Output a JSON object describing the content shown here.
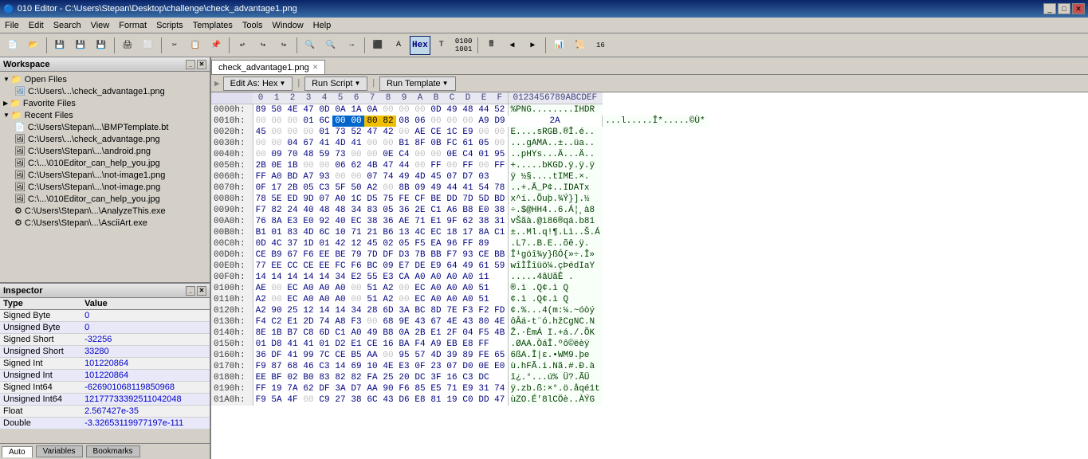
{
  "titlebar": {
    "title": "010 Editor - C:\\Users\\Stepan\\Desktop\\challenge\\check_advantage1.png"
  },
  "menubar": {
    "items": [
      "File",
      "Edit",
      "Search",
      "View",
      "Format",
      "Scripts",
      "Templates",
      "Tools",
      "Window",
      "Help"
    ]
  },
  "workspace": {
    "label": "Workspace",
    "open_files": {
      "label": "Open Files",
      "items": [
        "C:\\Users\\...\\check_advantage1.png"
      ]
    },
    "favorite_files": {
      "label": "Favorite Files"
    },
    "recent_files": {
      "label": "Recent Files",
      "items": [
        "C:\\Users\\Stepan\\...\\BMPTemplate.bt",
        "C:\\Users\\...\\check_advantage.png",
        "C:\\Users\\Stepan\\...\\android.png",
        "C:\\...\\010Editor_can_help_you.jpg",
        "C:\\Users\\Stepan\\...\\not-image1.png",
        "C:\\Users\\Stepan\\...\\not-image.png",
        "C:\\...\\010Editor_can_help_you.jpg",
        "C:\\Users\\Stepan\\...\\AnalyzeThis.exe",
        "C:\\Users\\Stepan\\...\\AsciiArt.exe"
      ]
    }
  },
  "inspector": {
    "label": "Inspector",
    "columns": [
      "Type",
      "Value"
    ],
    "rows": [
      {
        "type": "Signed Byte",
        "value": "0"
      },
      {
        "type": "Unsigned Byte",
        "value": "0"
      },
      {
        "type": "Signed Short",
        "value": "-32256"
      },
      {
        "type": "Unsigned Short",
        "value": "33280"
      },
      {
        "type": "Signed Int",
        "value": "101220864"
      },
      {
        "type": "Unsigned Int",
        "value": "101220864"
      },
      {
        "type": "Signed Int64",
        "value": "-626901068119850968"
      },
      {
        "type": "Unsigned Int64",
        "value": "12177733392511042048"
      },
      {
        "type": "Float",
        "value": "2.567427e-35"
      },
      {
        "type": "Double",
        "value": "-3.32653119977197e-111"
      }
    ],
    "tabs": [
      "Auto",
      "Variables",
      "Bookmarks"
    ]
  },
  "hex_editor": {
    "file_tab": "check_advantage1.png",
    "action_buttons": [
      "Edit As: Hex",
      "Run Script",
      "Run Template"
    ],
    "col_headers": [
      "0",
      "1",
      "2",
      "3",
      "4",
      "5",
      "6",
      "7",
      "8",
      "9",
      "A",
      "B",
      "C",
      "D",
      "E",
      "F",
      "0123456789ABCDEF"
    ],
    "rows": [
      {
        "addr": "0000h:",
        "bytes": [
          "89",
          "50",
          "4E",
          "47",
          "0D",
          "0A",
          "1A",
          "0A",
          "00",
          "00",
          "00",
          "0D",
          "49",
          "48",
          "44",
          "52"
        ],
        "ascii": "%PNG........IHDR"
      },
      {
        "addr": "0010h:",
        "bytes": [
          "00",
          "00",
          "00",
          "01",
          "6C",
          "00",
          "00",
          "80",
          "82",
          "08",
          "06",
          "00",
          "00",
          "00",
          "A9",
          "D9",
          "2A"
        ],
        "ascii": "...l.....Î*.....©Ù*",
        "sel1": [
          5,
          6
        ],
        "sel2": [
          7,
          8
        ]
      },
      {
        "addr": "0020h:",
        "bytes": [
          "45",
          "00",
          "00",
          "00",
          "01",
          "73",
          "52",
          "47",
          "42",
          "00",
          "AE",
          "CE",
          "1C",
          "E9",
          "00",
          "00"
        ],
        "ascii": "E....sRGB.®Î.é.."
      },
      {
        "addr": "0030h:",
        "bytes": [
          "00",
          "00",
          "04",
          "67",
          "41",
          "4D",
          "41",
          "00",
          "00",
          "B1",
          "8F",
          "0B",
          "FC",
          "61",
          "05",
          "00"
        ],
        "ascii": "...gAMA..±..üa.."
      },
      {
        "addr": "0040h:",
        "bytes": [
          "00",
          "09",
          "70",
          "48",
          "59",
          "73",
          "00",
          "00",
          "0E",
          "C4",
          "00",
          "00",
          "0E",
          "C4",
          "01",
          "95"
        ],
        "ascii": "..pHYs...Ä...Ä.."
      },
      {
        "addr": "0050h:",
        "bytes": [
          "2B",
          "0E",
          "1B",
          "00",
          "00",
          "06",
          "62",
          "4B",
          "47",
          "44",
          "00",
          "FF",
          "00",
          "FF",
          "00",
          "FF"
        ],
        "ascii": "+.....bKGD.ÿ.ÿ.ÿ"
      },
      {
        "addr": "0060h:",
        "bytes": [
          "FF",
          "A0",
          "BD",
          "A7",
          "93",
          "00",
          "00",
          "07",
          "74",
          "49",
          "4D",
          "45",
          "07",
          "D7",
          "03"
        ],
        "ascii": "ÿ ½§....tIME.×."
      },
      {
        "addr": "0070h:",
        "bytes": [
          "0F",
          "17",
          "2B",
          "05",
          "C3",
          "5F",
          "50",
          "A2",
          "00",
          "8B",
          "09",
          "49",
          "44",
          "41",
          "54",
          "78"
        ],
        "ascii": "..+.Ã_P¢..IDATx"
      },
      {
        "addr": "0080h:",
        "bytes": [
          "78",
          "5E",
          "ED",
          "9D",
          "07",
          "A0",
          "1C",
          "D5",
          "75",
          "FE",
          "CF",
          "BE",
          "DD",
          "7D",
          "5D",
          "BD"
        ],
        "ascii": "x^í..Õuþ.¾Ý}].½"
      },
      {
        "addr": "0090h:",
        "bytes": [
          "F7",
          "82",
          "24",
          "40",
          "48",
          "48",
          "34",
          "83",
          "05",
          "36",
          "2E",
          "C1",
          "A6",
          "B8",
          "E0",
          "38"
        ],
        "ascii": "÷.$@HH4..6.Á¦¸à8"
      },
      {
        "addr": "00A0h:",
        "bytes": [
          "76",
          "8A",
          "E3",
          "E0",
          "92",
          "40",
          "EC",
          "38",
          "36",
          "AE",
          "71",
          "E1",
          "9F",
          "62",
          "38",
          "31"
        ],
        "ascii": "vŠãà.@ì86®qá.b81"
      },
      {
        "addr": "00B0h:",
        "bytes": [
          "B1",
          "01",
          "83",
          "4D",
          "6C",
          "10",
          "71",
          "21",
          "B6",
          "13",
          "4C",
          "EC",
          "18",
          "17",
          "8A",
          "C1"
        ],
        "ascii": "±..Ml.q!¶.Lì..Š.Á"
      },
      {
        "addr": "00C0h:",
        "bytes": [
          "0D",
          "4C",
          "37",
          "1D",
          "01",
          "42",
          "12",
          "45",
          "02",
          "05",
          "F5",
          "EA",
          "96",
          "FF",
          "89"
        ],
        "ascii": ".L7..B.E..õê.ÿ."
      },
      {
        "addr": "00D0h:",
        "bytes": [
          "CE",
          "B9",
          "67",
          "F6",
          "EE",
          "BE",
          "79",
          "7D",
          "DF",
          "D3",
          "7B",
          "BB",
          "F7",
          "93",
          "CE",
          "BB"
        ],
        "ascii": "Î¹göî¾y}ßÓ{»÷.Î»"
      },
      {
        "addr": "00E0h:",
        "bytes": [
          "77",
          "EE",
          "CC",
          "CE",
          "EE",
          "FC",
          "F6",
          "BC",
          "09",
          "E7",
          "DE",
          "E9",
          "64",
          "49",
          "61",
          "59"
        ],
        "ascii": "wîÌÎîüö¼.çÞédIaY"
      },
      {
        "addr": "00F0h:",
        "bytes": [
          "14",
          "14",
          "14",
          "14",
          "14",
          "34",
          "E2",
          "55",
          "E3",
          "CA",
          "A0",
          "A0",
          "A0",
          "A0",
          "11"
        ],
        "ascii": ".....4âUãÊ     ."
      },
      {
        "addr": "0100h:",
        "bytes": [
          "AE",
          "00",
          "EC",
          "A0",
          "A0",
          "A0",
          "00",
          "51",
          "A2",
          "00",
          "EC",
          "A0",
          "A0",
          "A0",
          "51"
        ],
        "ascii": "®.ì   .Q¢.ì   Q"
      },
      {
        "addr": "0110h:",
        "bytes": [
          "A2",
          "00",
          "EC",
          "A0",
          "A0",
          "A0",
          "00",
          "51",
          "A2",
          "00",
          "EC",
          "A0",
          "A0",
          "A0",
          "51"
        ],
        "ascii": "¢.ì   .Q¢.ì   Q"
      },
      {
        "addr": "0120h:",
        "bytes": [
          "A2",
          "90",
          "25",
          "12",
          "14",
          "14",
          "34",
          "28",
          "6D",
          "3A",
          "BC",
          "8D",
          "7E",
          "F3",
          "F2",
          "FD"
        ],
        "ascii": "¢.%...4(m:¼.~óòý"
      },
      {
        "addr": "0130h:",
        "bytes": [
          "F4",
          "C2",
          "E1",
          "2D",
          "74",
          "A8",
          "F3",
          "00",
          "68",
          "9E",
          "43",
          "67",
          "4E",
          "43",
          "80",
          "4E"
        ],
        "ascii": "ôÂá-t¨ó.hžCgNC.N"
      },
      {
        "addr": "0140h:",
        "bytes": [
          "8E",
          "1B",
          "B7",
          "C8",
          "6D",
          "C1",
          "A0",
          "49",
          "B8",
          "0A",
          "2B",
          "E1",
          "2F",
          "04",
          "F5",
          "4B"
        ],
        "ascii": "Ž.·ÈmÁ I.+á./.ÕK"
      },
      {
        "addr": "0150h:",
        "bytes": [
          "01",
          "D8",
          "41",
          "41",
          "01",
          "D2",
          "E1",
          "CE",
          "16",
          "BA",
          "F4",
          "A9",
          "EB",
          "E8",
          "FF"
        ],
        "ascii": ".ØAA.ÒáÎ.ºô©ëèÿ"
      },
      {
        "addr": "0160h:",
        "bytes": [
          "36",
          "DF",
          "41",
          "99",
          "7C",
          "CE",
          "B5",
          "AA",
          "00",
          "95",
          "57",
          "4D",
          "39",
          "89",
          "FE",
          "65"
        ],
        "ascii": "6ßA.Î|ε.•WM9.þe"
      },
      {
        "addr": "0170h:",
        "bytes": [
          "F9",
          "87",
          "68",
          "46",
          "C3",
          "14",
          "69",
          "10",
          "4E",
          "E3",
          "0F",
          "23",
          "07",
          "D0",
          "0E",
          "E0"
        ],
        "ascii": "ù.hFÃ.i.Nã.#.Ð.à"
      },
      {
        "addr": "0180h:",
        "bytes": [
          "EE",
          "BF",
          "02",
          "B0",
          "83",
          "82",
          "82",
          "FA",
          "25",
          "20",
          "DC",
          "3F",
          "16",
          "C3",
          "DC"
        ],
        "ascii": "î¿.°...ú% Ü?.ÃÜ"
      },
      {
        "addr": "0190h:",
        "bytes": [
          "FF",
          "19",
          "7A",
          "62",
          "DF",
          "3A",
          "D7",
          "AA",
          "90",
          "F6",
          "85",
          "E5",
          "71",
          "E9",
          "31",
          "74"
        ],
        "ascii": "ÿ.zb.ß:×°.ö.åqé1t"
      },
      {
        "addr": "01A0h:",
        "bytes": [
          "F9",
          "5A",
          "4F",
          "00",
          "C9",
          "27",
          "38",
          "6C",
          "43",
          "D6",
          "E8",
          "81",
          "19",
          "C0",
          "DD",
          "47"
        ],
        "ascii": "ùZO.É'8lCÖè..ÀÝG"
      }
    ]
  }
}
